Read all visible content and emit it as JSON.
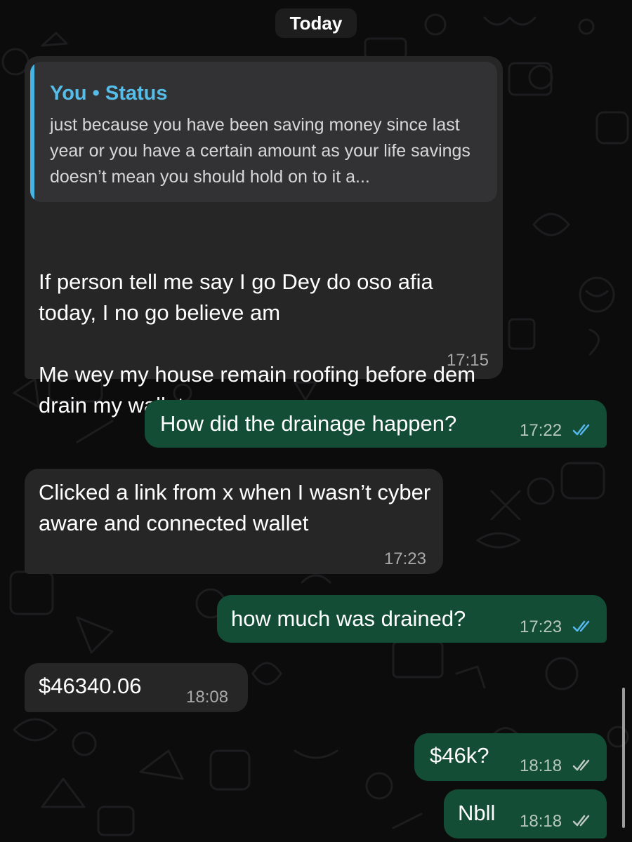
{
  "date_label": "Today",
  "messages": [
    {
      "direction": "incoming",
      "quote": {
        "author": "You • Status",
        "text": "just because you have been saving money since last year or you have a certain amount as your life savings doesn’t mean you should hold on to it a..."
      },
      "text": "If person tell me say I go Dey do oso afia today, I no go believe am\n\nMe wey my house remain roofing before dem drain my wallet",
      "time": "17:15"
    },
    {
      "direction": "outgoing",
      "text": "How did the drainage happen?",
      "time": "17:22",
      "status": "read"
    },
    {
      "direction": "incoming",
      "text": "Clicked a link from x when I wasn’t cyber aware and connected wallet",
      "time": "17:23"
    },
    {
      "direction": "outgoing",
      "text": "how much was drained?",
      "time": "17:23",
      "status": "read"
    },
    {
      "direction": "incoming",
      "text": "$46340.06",
      "time": "18:08"
    },
    {
      "direction": "outgoing",
      "text": "$46k?",
      "time": "18:18",
      "status": "delivered"
    },
    {
      "direction": "outgoing",
      "text": "Nbll",
      "time": "18:18",
      "status": "delivered"
    }
  ],
  "colors": {
    "background": "#0c0c0d",
    "incoming_bubble": "#262627",
    "outgoing_bubble": "#144d36",
    "quote_accent": "#47b5e4",
    "read_ticks": "#56b8ee",
    "delivered_ticks": "#bfcac4"
  },
  "icons": {
    "read_receipt": "double-check-icon",
    "delivered_receipt": "double-check-icon"
  }
}
